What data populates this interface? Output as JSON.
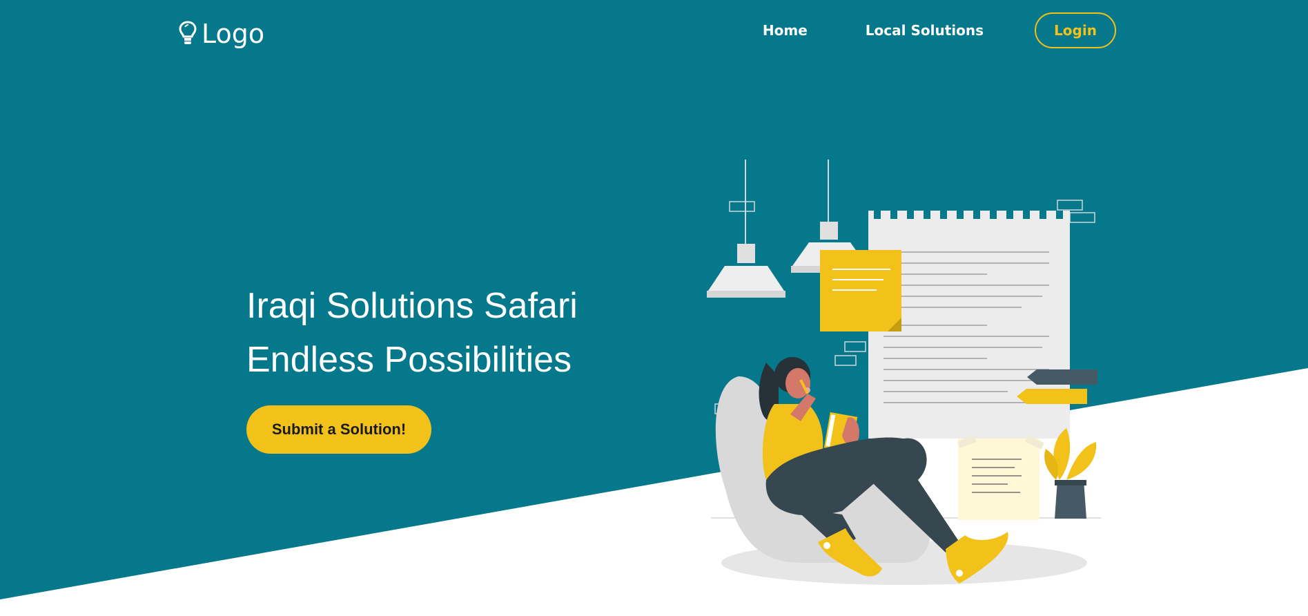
{
  "colors": {
    "teal": "#06788b",
    "yellow": "#f2c21b",
    "white": "#ffffff",
    "dark": "#37474f"
  },
  "header": {
    "logo_icon": "lightbulb-icon",
    "logo_text": "Logo",
    "nav": {
      "home": "Home",
      "local_solutions": "Local Solutions",
      "login": "Login"
    }
  },
  "hero": {
    "title_line1": "Iraqi Solutions Safari",
    "title_line2": "Endless Possibilities",
    "cta_label": "Submit a Solution!"
  },
  "illustration": {
    "description_icon": "woman-reading-notes-illustration"
  }
}
